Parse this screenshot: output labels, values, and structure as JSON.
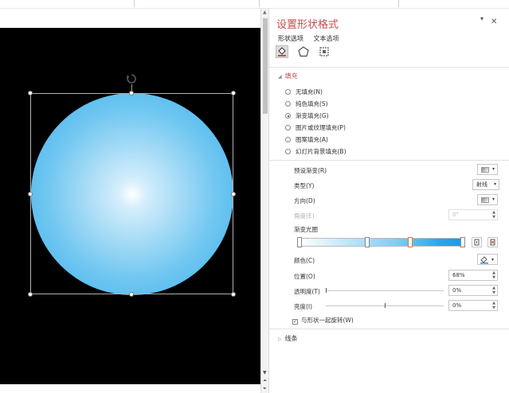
{
  "panel": {
    "title": "设置形状格式",
    "tabs": [
      {
        "label": "形状选项"
      },
      {
        "label": "文本选项"
      }
    ],
    "fill_section": {
      "header": "填充",
      "options": [
        {
          "label": "无填充(N)",
          "selected": false
        },
        {
          "label": "纯色填充(S)",
          "selected": false
        },
        {
          "label": "渐变填充(G)",
          "selected": true
        },
        {
          "label": "图片或纹理填充(P)",
          "selected": false
        },
        {
          "label": "图案填充(A)",
          "selected": false
        },
        {
          "label": "幻灯片背景填充(B)",
          "selected": false
        }
      ],
      "preset_gradient": {
        "label": "预设渐变(R)"
      },
      "type": {
        "label": "类型(Y)",
        "value": "射线"
      },
      "direction": {
        "label": "方向(D)"
      },
      "angle": {
        "label": "角度(E)",
        "value": "0°"
      },
      "gradient_stops": {
        "label": "渐变光圈",
        "stops": [
          0,
          0.32,
          0.68,
          1
        ],
        "selected_stop": 2
      },
      "color": {
        "label": "颜色(C)"
      },
      "position": {
        "label": "位置(O)",
        "value": "68%"
      },
      "transparency": {
        "label": "透明度(T)",
        "value": "0%",
        "level": 0
      },
      "brightness": {
        "label": "亮度(I)",
        "value": "0%",
        "level": 0.5
      },
      "rotate_with_shape": {
        "label": "与形状一起旋转(W)",
        "checked": true
      }
    },
    "line_section": {
      "header": "线条"
    }
  },
  "icons": {
    "pin": "pin-icon",
    "close": "close-icon",
    "fill_line": "fill-line-icon",
    "effects": "pentagon-effects-icon",
    "size": "size-properties-icon",
    "rotate": "rotate-handle-icon"
  },
  "colors": {
    "accent": "#c0504d",
    "shape_center": "#ffffff",
    "shape_edge": "#3bb0ec"
  }
}
